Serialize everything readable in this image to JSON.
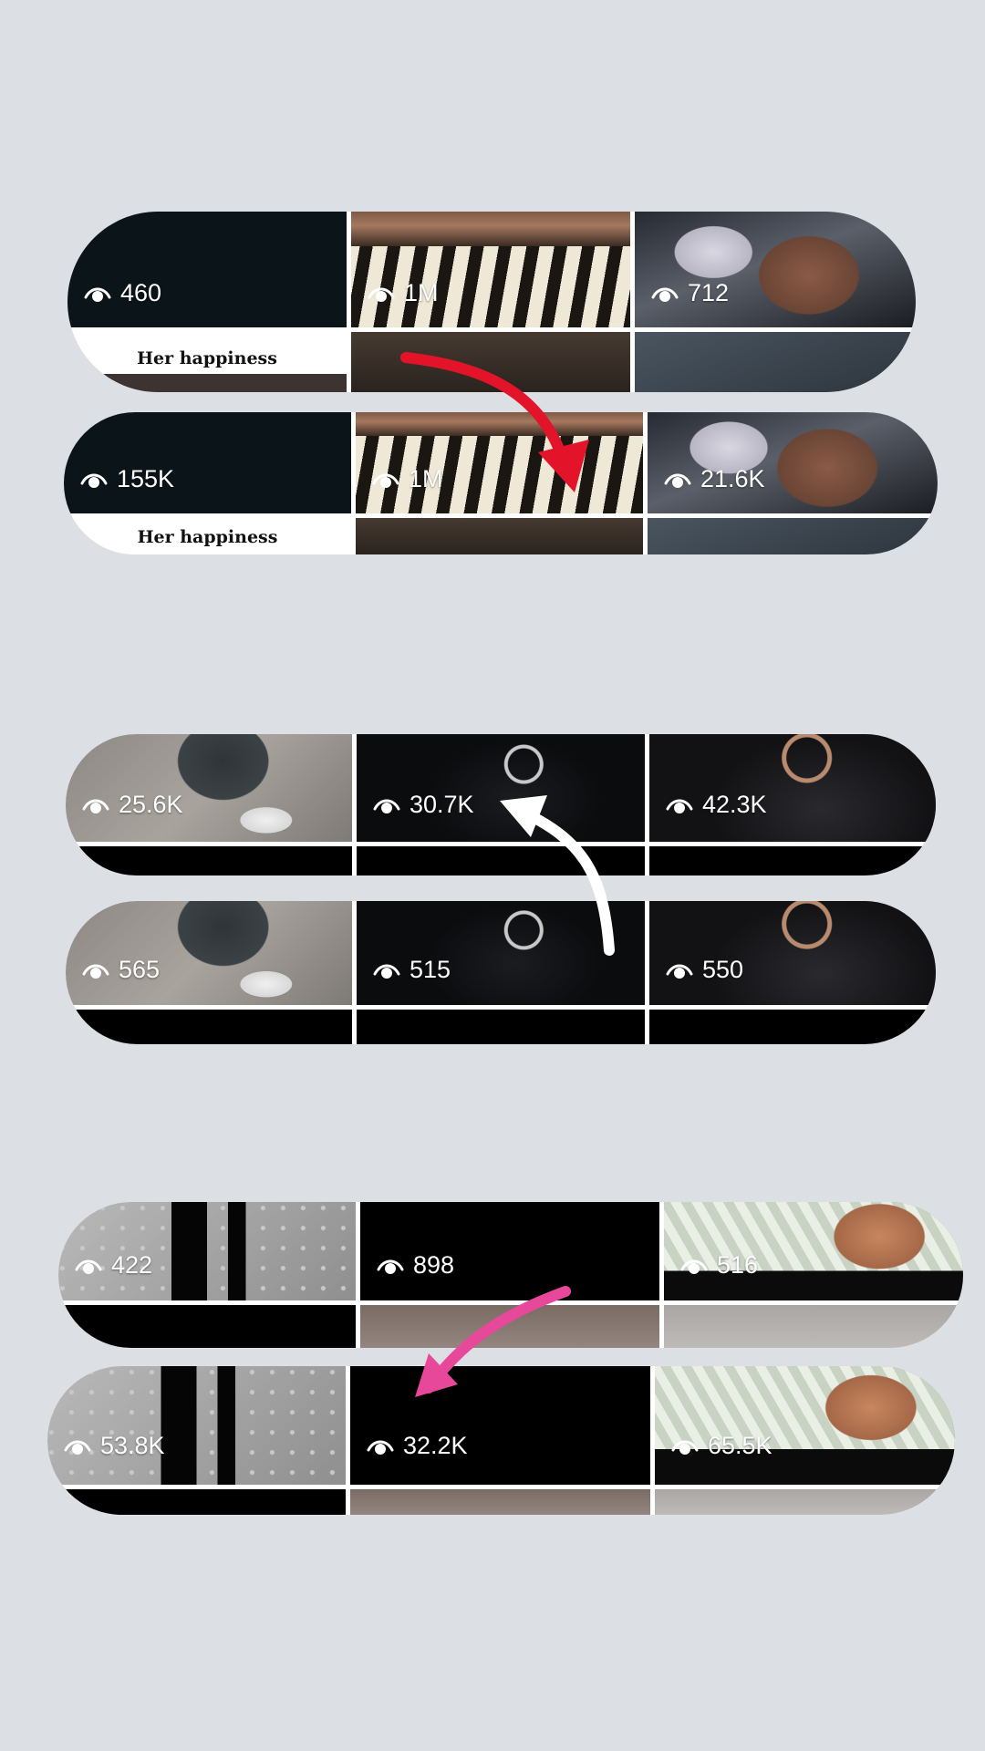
{
  "groups": [
    {
      "rows": [
        {
          "views": [
            "460",
            "1M",
            "712"
          ],
          "caption": "Her happiness"
        },
        {
          "views": [
            "155K",
            "1M",
            "21.6K"
          ],
          "caption": "Her happiness"
        }
      ],
      "arrow_color": "#e3142a"
    },
    {
      "rows": [
        {
          "views": [
            "25.6K",
            "30.7K",
            "42.3K"
          ]
        },
        {
          "views": [
            "565",
            "515",
            "550"
          ]
        }
      ],
      "arrow_color": "#ffffff"
    },
    {
      "rows": [
        {
          "views": [
            "422",
            "898",
            "516"
          ]
        },
        {
          "views": [
            "53.8K",
            "32.2K",
            "65.5K"
          ]
        }
      ],
      "arrow_color": "#e8489a"
    }
  ],
  "icons": {
    "views": "eye-icon"
  },
  "colors": {
    "background": "#dcdfe4",
    "divider": "#ffffff"
  }
}
